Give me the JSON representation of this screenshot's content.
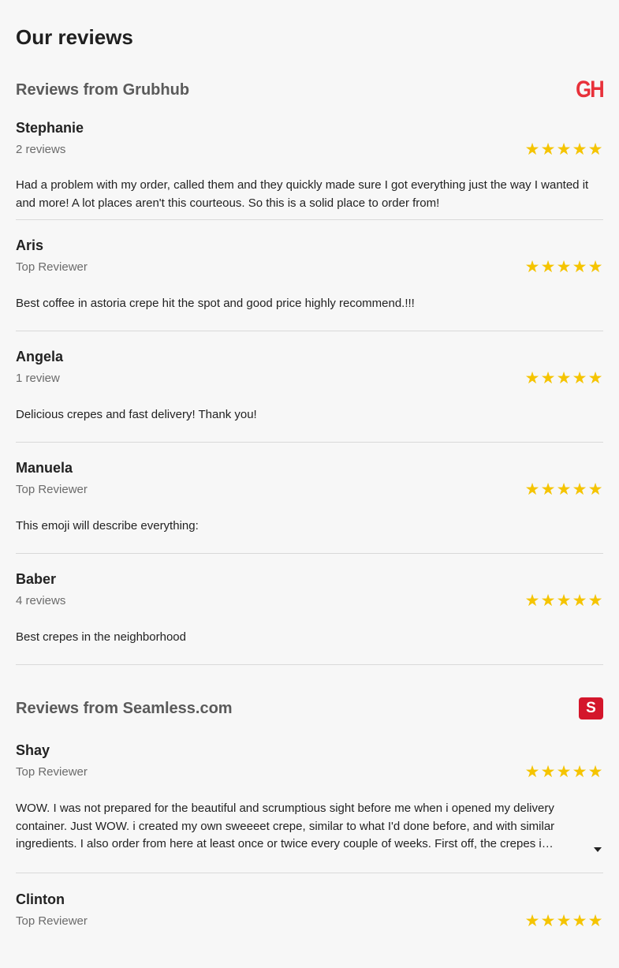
{
  "page": {
    "title": "Our reviews"
  },
  "colors": {
    "star": "#f5c400",
    "grubhub_brand": "#e8313a",
    "seamless_brand": "#d4162b"
  },
  "sources": [
    {
      "title": "Reviews from Grubhub",
      "logo_text": "GH",
      "logo_icon": "grubhub-logo-icon",
      "reviews": [
        {
          "name": "Stephanie",
          "meta": "2 reviews",
          "rating": 5,
          "text": "Had a problem with my order, called them and they quickly made sure I got everything just the way I wanted it and more! A lot places aren't this courteous. So this is a solid place to order from!"
        },
        {
          "name": "Aris",
          "meta": "Top Reviewer",
          "rating": 5,
          "text": "Best coffee in astoria crepe hit the spot and good price highly recommend.!!!"
        },
        {
          "name": "Angela",
          "meta": "1 review",
          "rating": 5,
          "text": "Delicious crepes and fast delivery! Thank you!"
        },
        {
          "name": "Manuela",
          "meta": "Top Reviewer",
          "rating": 5,
          "text": "This emoji will describe everything:"
        },
        {
          "name": "Baber",
          "meta": "4 reviews",
          "rating": 5,
          "text": "Best crepes in the neighborhood"
        }
      ]
    },
    {
      "title": "Reviews from Seamless.com",
      "logo_text": "S",
      "logo_icon": "seamless-logo-icon",
      "reviews": [
        {
          "name": "Shay",
          "meta": "Top Reviewer",
          "rating": 5,
          "text": "WOW. I was not prepared for the beautiful and scrumptious sight before me when i opened my delivery container. Just WOW. i created my own sweeeet crepe, similar to what I'd done before, and with similar ingredients. I also order from here at least once or twice every couple of weeks. First off, the crepes i ordered…",
          "expand_icon": "chevron-down-icon"
        },
        {
          "name": "Clinton",
          "meta": "Top Reviewer",
          "rating": 5,
          "text": ""
        }
      ]
    }
  ]
}
